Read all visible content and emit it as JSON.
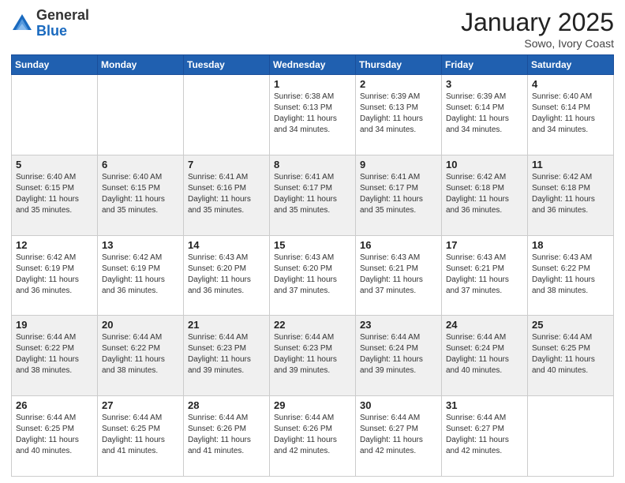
{
  "logo": {
    "general": "General",
    "blue": "Blue"
  },
  "header": {
    "month": "January 2025",
    "location": "Sowo, Ivory Coast"
  },
  "weekdays": [
    "Sunday",
    "Monday",
    "Tuesday",
    "Wednesday",
    "Thursday",
    "Friday",
    "Saturday"
  ],
  "weeks": [
    [
      {
        "day": "",
        "info": ""
      },
      {
        "day": "",
        "info": ""
      },
      {
        "day": "",
        "info": ""
      },
      {
        "day": "1",
        "info": "Sunrise: 6:38 AM\nSunset: 6:13 PM\nDaylight: 11 hours\nand 34 minutes."
      },
      {
        "day": "2",
        "info": "Sunrise: 6:39 AM\nSunset: 6:13 PM\nDaylight: 11 hours\nand 34 minutes."
      },
      {
        "day": "3",
        "info": "Sunrise: 6:39 AM\nSunset: 6:14 PM\nDaylight: 11 hours\nand 34 minutes."
      },
      {
        "day": "4",
        "info": "Sunrise: 6:40 AM\nSunset: 6:14 PM\nDaylight: 11 hours\nand 34 minutes."
      }
    ],
    [
      {
        "day": "5",
        "info": "Sunrise: 6:40 AM\nSunset: 6:15 PM\nDaylight: 11 hours\nand 35 minutes."
      },
      {
        "day": "6",
        "info": "Sunrise: 6:40 AM\nSunset: 6:15 PM\nDaylight: 11 hours\nand 35 minutes."
      },
      {
        "day": "7",
        "info": "Sunrise: 6:41 AM\nSunset: 6:16 PM\nDaylight: 11 hours\nand 35 minutes."
      },
      {
        "day": "8",
        "info": "Sunrise: 6:41 AM\nSunset: 6:17 PM\nDaylight: 11 hours\nand 35 minutes."
      },
      {
        "day": "9",
        "info": "Sunrise: 6:41 AM\nSunset: 6:17 PM\nDaylight: 11 hours\nand 35 minutes."
      },
      {
        "day": "10",
        "info": "Sunrise: 6:42 AM\nSunset: 6:18 PM\nDaylight: 11 hours\nand 36 minutes."
      },
      {
        "day": "11",
        "info": "Sunrise: 6:42 AM\nSunset: 6:18 PM\nDaylight: 11 hours\nand 36 minutes."
      }
    ],
    [
      {
        "day": "12",
        "info": "Sunrise: 6:42 AM\nSunset: 6:19 PM\nDaylight: 11 hours\nand 36 minutes."
      },
      {
        "day": "13",
        "info": "Sunrise: 6:42 AM\nSunset: 6:19 PM\nDaylight: 11 hours\nand 36 minutes."
      },
      {
        "day": "14",
        "info": "Sunrise: 6:43 AM\nSunset: 6:20 PM\nDaylight: 11 hours\nand 36 minutes."
      },
      {
        "day": "15",
        "info": "Sunrise: 6:43 AM\nSunset: 6:20 PM\nDaylight: 11 hours\nand 37 minutes."
      },
      {
        "day": "16",
        "info": "Sunrise: 6:43 AM\nSunset: 6:21 PM\nDaylight: 11 hours\nand 37 minutes."
      },
      {
        "day": "17",
        "info": "Sunrise: 6:43 AM\nSunset: 6:21 PM\nDaylight: 11 hours\nand 37 minutes."
      },
      {
        "day": "18",
        "info": "Sunrise: 6:43 AM\nSunset: 6:22 PM\nDaylight: 11 hours\nand 38 minutes."
      }
    ],
    [
      {
        "day": "19",
        "info": "Sunrise: 6:44 AM\nSunset: 6:22 PM\nDaylight: 11 hours\nand 38 minutes."
      },
      {
        "day": "20",
        "info": "Sunrise: 6:44 AM\nSunset: 6:22 PM\nDaylight: 11 hours\nand 38 minutes."
      },
      {
        "day": "21",
        "info": "Sunrise: 6:44 AM\nSunset: 6:23 PM\nDaylight: 11 hours\nand 39 minutes."
      },
      {
        "day": "22",
        "info": "Sunrise: 6:44 AM\nSunset: 6:23 PM\nDaylight: 11 hours\nand 39 minutes."
      },
      {
        "day": "23",
        "info": "Sunrise: 6:44 AM\nSunset: 6:24 PM\nDaylight: 11 hours\nand 39 minutes."
      },
      {
        "day": "24",
        "info": "Sunrise: 6:44 AM\nSunset: 6:24 PM\nDaylight: 11 hours\nand 40 minutes."
      },
      {
        "day": "25",
        "info": "Sunrise: 6:44 AM\nSunset: 6:25 PM\nDaylight: 11 hours\nand 40 minutes."
      }
    ],
    [
      {
        "day": "26",
        "info": "Sunrise: 6:44 AM\nSunset: 6:25 PM\nDaylight: 11 hours\nand 40 minutes."
      },
      {
        "day": "27",
        "info": "Sunrise: 6:44 AM\nSunset: 6:25 PM\nDaylight: 11 hours\nand 41 minutes."
      },
      {
        "day": "28",
        "info": "Sunrise: 6:44 AM\nSunset: 6:26 PM\nDaylight: 11 hours\nand 41 minutes."
      },
      {
        "day": "29",
        "info": "Sunrise: 6:44 AM\nSunset: 6:26 PM\nDaylight: 11 hours\nand 42 minutes."
      },
      {
        "day": "30",
        "info": "Sunrise: 6:44 AM\nSunset: 6:27 PM\nDaylight: 11 hours\nand 42 minutes."
      },
      {
        "day": "31",
        "info": "Sunrise: 6:44 AM\nSunset: 6:27 PM\nDaylight: 11 hours\nand 42 minutes."
      },
      {
        "day": "",
        "info": ""
      }
    ]
  ]
}
